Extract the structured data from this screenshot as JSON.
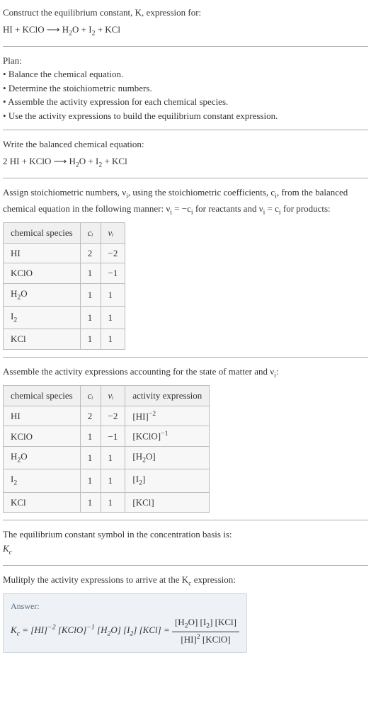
{
  "intro": {
    "line1": "Construct the equilibrium constant, K, expression for:",
    "equation_html": "HI + KClO  ⟶  H<sub>2</sub>O + I<sub>2</sub> + KCl"
  },
  "plan": {
    "heading": "Plan:",
    "items": [
      "Balance the chemical equation.",
      "Determine the stoichiometric numbers.",
      "Assemble the activity expression for each chemical species.",
      "Use the activity expressions to build the equilibrium constant expression."
    ]
  },
  "balanced": {
    "heading": "Write the balanced chemical equation:",
    "equation_html": "2 HI + KClO  ⟶  H<sub>2</sub>O + I<sub>2</sub> + KCl"
  },
  "assign": {
    "paragraph_html": "Assign stoichiometric numbers, ν<sub>i</sub>, using the stoichiometric coefficients, c<sub>i</sub>, from the balanced chemical equation in the following manner: ν<sub>i</sub> = −c<sub>i</sub> for reactants and ν<sub>i</sub> = c<sub>i</sub> for products:",
    "headers": [
      "chemical species",
      "cᵢ",
      "νᵢ"
    ],
    "rows": [
      {
        "species_html": "HI",
        "ci": "2",
        "nui": "−2"
      },
      {
        "species_html": "KClO",
        "ci": "1",
        "nui": "−1"
      },
      {
        "species_html": "H<sub>2</sub>O",
        "ci": "1",
        "nui": "1"
      },
      {
        "species_html": "I<sub>2</sub>",
        "ci": "1",
        "nui": "1"
      },
      {
        "species_html": "KCl",
        "ci": "1",
        "nui": "1"
      }
    ]
  },
  "activity": {
    "heading_html": "Assemble the activity expressions accounting for the state of matter and ν<sub>i</sub>:",
    "headers": [
      "chemical species",
      "cᵢ",
      "νᵢ",
      "activity expression"
    ],
    "rows": [
      {
        "species_html": "HI",
        "ci": "2",
        "nui": "−2",
        "expr_html": "[HI]<sup>−2</sup>"
      },
      {
        "species_html": "KClO",
        "ci": "1",
        "nui": "−1",
        "expr_html": "[KClO]<sup>−1</sup>"
      },
      {
        "species_html": "H<sub>2</sub>O",
        "ci": "1",
        "nui": "1",
        "expr_html": "[H<sub>2</sub>O]"
      },
      {
        "species_html": "I<sub>2</sub>",
        "ci": "1",
        "nui": "1",
        "expr_html": "[I<sub>2</sub>]"
      },
      {
        "species_html": "KCl",
        "ci": "1",
        "nui": "1",
        "expr_html": "[KCl]"
      }
    ]
  },
  "symbol": {
    "heading": "The equilibrium constant symbol in the concentration basis is:",
    "value_html": "K<sub>c</sub>"
  },
  "multiply": {
    "heading_html": "Mulitply the activity expressions to arrive at the K<sub>c</sub> expression:"
  },
  "answer": {
    "label": "Answer:",
    "lhs_html": "K<sub>c</sub> = [HI]<sup>−2</sup> [KClO]<sup>−1</sup> [H<sub>2</sub>O] [I<sub>2</sub>] [KCl] =",
    "frac_num_html": "[H<sub>2</sub>O] [I<sub>2</sub>] [KCl]",
    "frac_den_html": "[HI]<sup>2</sup> [KClO]"
  }
}
